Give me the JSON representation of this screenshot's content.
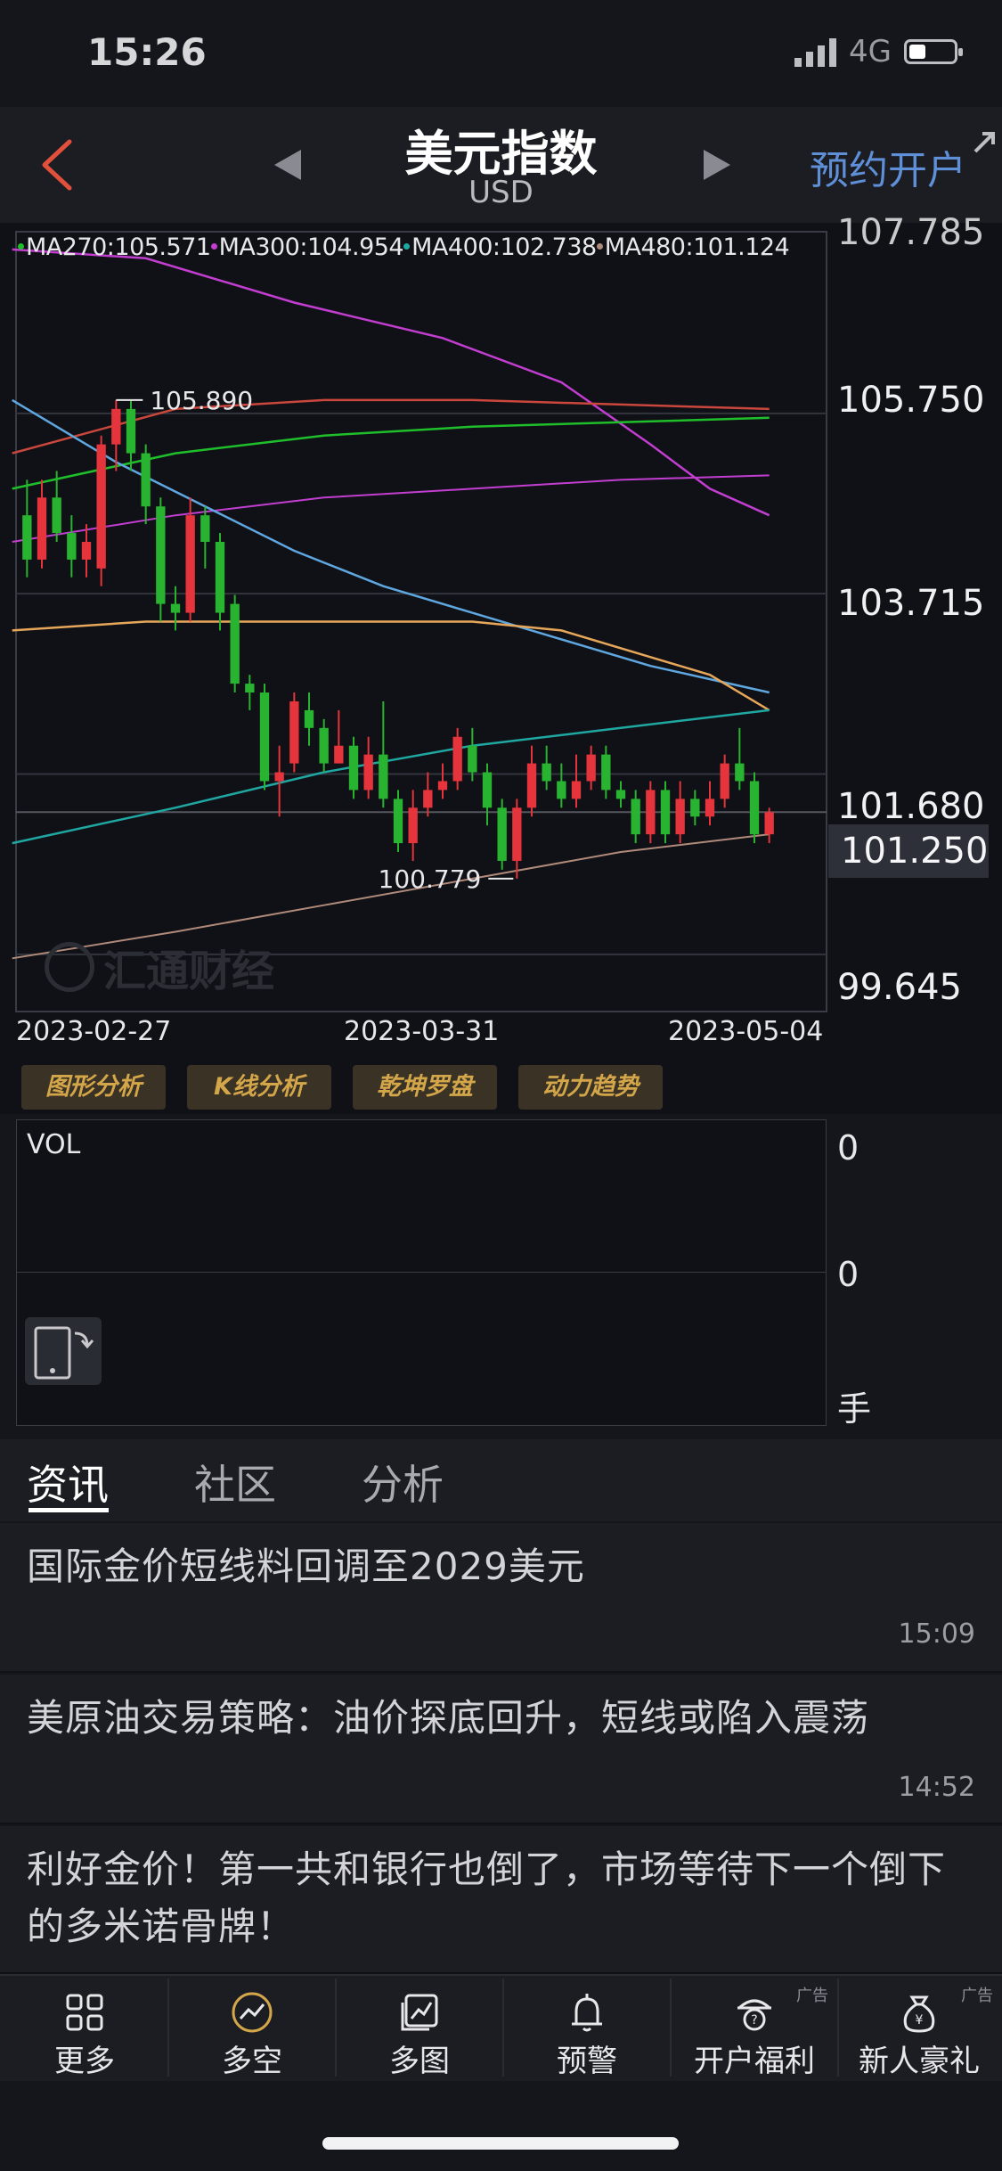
{
  "status_bar": {
    "time": "15:26",
    "network": "4G"
  },
  "header": {
    "title": "美元指数",
    "subtitle": "USD",
    "reserve_label": "预约开户"
  },
  "chart_data": {
    "type": "candlestick",
    "ma_legend": [
      {
        "label": "MA270:105.571",
        "color": "#1fbf2b"
      },
      {
        "label": "MA300:104.954",
        "color": "#c23ed0"
      },
      {
        "label": "MA400:102.738",
        "color": "#1fa7a2"
      },
      {
        "label": "MA480:101.124",
        "color": "#b08a7a"
      }
    ],
    "y_axis": {
      "ticks": [
        "105.750",
        "103.715",
        "101.680",
        "99.645"
      ],
      "top_partial": "107.785",
      "range": [
        99.0,
        107.8
      ]
    },
    "x_axis": {
      "ticks": [
        "2023-02-27",
        "2023-03-31",
        "2023-05-04"
      ]
    },
    "last_price": "101.250",
    "high_label": "105.890",
    "low_label": "100.779",
    "candles": [
      [
        104.6,
        104.1,
        105.0,
        103.9
      ],
      [
        104.1,
        104.8,
        105.0,
        104.0
      ],
      [
        104.8,
        104.4,
        105.1,
        104.3
      ],
      [
        104.4,
        104.1,
        104.6,
        103.9
      ],
      [
        104.1,
        104.3,
        104.5,
        103.9
      ],
      [
        104.0,
        105.4,
        105.5,
        103.8
      ],
      [
        105.4,
        105.8,
        105.9,
        105.1
      ],
      [
        105.8,
        105.3,
        105.9,
        105.1
      ],
      [
        105.3,
        104.7,
        105.4,
        104.5
      ],
      [
        104.7,
        103.6,
        104.8,
        103.4
      ],
      [
        103.6,
        103.5,
        103.8,
        103.3
      ],
      [
        103.5,
        104.6,
        104.8,
        103.4
      ],
      [
        104.6,
        104.3,
        104.7,
        104.0
      ],
      [
        104.3,
        103.5,
        104.4,
        103.3
      ],
      [
        103.6,
        102.7,
        103.7,
        102.6
      ],
      [
        102.7,
        102.6,
        102.8,
        102.4
      ],
      [
        102.6,
        101.6,
        102.7,
        101.5
      ],
      [
        101.6,
        101.7,
        102.0,
        101.2
      ],
      [
        101.8,
        102.5,
        102.6,
        101.7
      ],
      [
        102.4,
        102.2,
        102.6,
        102.0
      ],
      [
        102.2,
        101.8,
        102.3,
        101.7
      ],
      [
        101.8,
        102.0,
        102.4,
        101.8
      ],
      [
        102.0,
        101.5,
        102.1,
        101.4
      ],
      [
        101.5,
        101.9,
        102.1,
        101.4
      ],
      [
        101.9,
        101.4,
        102.5,
        101.3
      ],
      [
        101.4,
        100.9,
        101.5,
        100.8
      ],
      [
        100.9,
        101.3,
        101.5,
        100.7
      ],
      [
        101.3,
        101.5,
        101.7,
        101.2
      ],
      [
        101.5,
        101.6,
        101.8,
        101.4
      ],
      [
        101.6,
        102.1,
        102.2,
        101.5
      ],
      [
        102.0,
        101.7,
        102.2,
        101.6
      ],
      [
        101.7,
        101.3,
        101.8,
        101.1
      ],
      [
        101.3,
        100.7,
        101.4,
        100.6
      ],
      [
        100.7,
        101.3,
        101.4,
        100.5
      ],
      [
        101.3,
        101.8,
        102.0,
        101.2
      ],
      [
        101.8,
        101.6,
        102.0,
        101.5
      ],
      [
        101.6,
        101.4,
        101.8,
        101.3
      ],
      [
        101.4,
        101.6,
        101.9,
        101.3
      ],
      [
        101.6,
        101.9,
        102.0,
        101.5
      ],
      [
        101.9,
        101.5,
        102.0,
        101.4
      ],
      [
        101.5,
        101.4,
        101.6,
        101.3
      ],
      [
        101.4,
        101.0,
        101.5,
        100.9
      ],
      [
        101.0,
        101.5,
        101.6,
        100.9
      ],
      [
        101.5,
        101.0,
        101.6,
        100.9
      ],
      [
        101.0,
        101.4,
        101.6,
        100.9
      ],
      [
        101.4,
        101.2,
        101.5,
        101.1
      ],
      [
        101.2,
        101.4,
        101.6,
        101.1
      ],
      [
        101.4,
        101.8,
        101.9,
        101.3
      ],
      [
        101.8,
        101.6,
        102.2,
        101.5
      ],
      [
        101.6,
        101.0,
        101.7,
        100.9
      ],
      [
        101.0,
        101.25,
        101.3,
        100.9
      ]
    ]
  },
  "analysis_buttons": [
    "图形分析",
    "K线分析",
    "乾坤罗盘",
    "动力趋势"
  ],
  "volume": {
    "label": "VOL",
    "tick_top": "0",
    "tick_mid": "0",
    "unit": "手"
  },
  "tabs": [
    "资讯",
    "社区",
    "分析"
  ],
  "news": [
    {
      "title": "国际金价短线料回调至2029美元",
      "time": "15:09"
    },
    {
      "title": "美原油交易策略：油价探底回升，短线或陷入震荡",
      "time": "14:52"
    },
    {
      "title": "利好金价！第一共和银行也倒了，市场等待下一个倒下的多米诺骨牌！",
      "time": ""
    }
  ],
  "bottom_nav": [
    {
      "label": "更多",
      "icon": "grid-icon",
      "ad": ""
    },
    {
      "label": "多空",
      "icon": "trend-icon",
      "ad": ""
    },
    {
      "label": "多图",
      "icon": "multi-chart-icon",
      "ad": ""
    },
    {
      "label": "预警",
      "icon": "bell-icon",
      "ad": ""
    },
    {
      "label": "开户福利",
      "icon": "gift-icon",
      "ad": "广告"
    },
    {
      "label": "新人豪礼",
      "icon": "money-bag-icon",
      "ad": "广告"
    }
  ],
  "watermark": "汇通财经"
}
